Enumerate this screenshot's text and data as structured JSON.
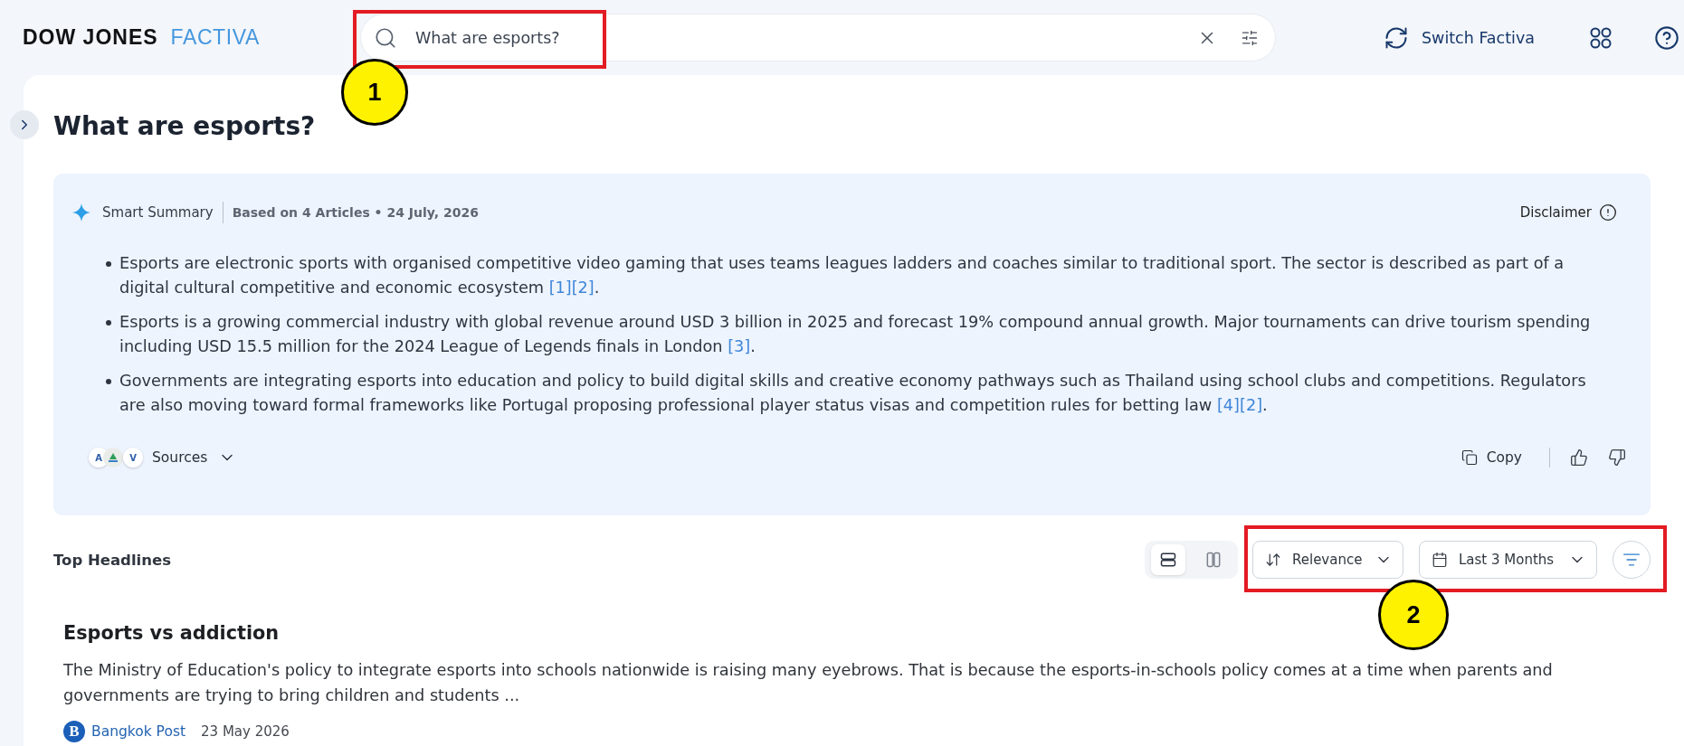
{
  "header": {
    "logo": {
      "primary": "DOW JONES",
      "secondary": "FACTIVA"
    },
    "search": {
      "value": "What are esports?",
      "callout": "1"
    },
    "switch_label": "Switch Factiva"
  },
  "page_title": "What are esports?",
  "summary": {
    "label": "Smart Summary",
    "meta": "Based on 4 Articles • 24 July, 2026",
    "disclaimer": "Disclaimer",
    "bullets": [
      {
        "text": "Esports are electronic sports with organised competitive video gaming that uses teams leagues ladders and coaches similar to traditional sport. The sector is described as part of a digital cultural competitive and economic ecosystem",
        "citations": [
          "[1]",
          "[2]"
        ],
        "end": "."
      },
      {
        "text": "Esports is a growing commercial industry with global revenue around USD 3 billion in 2025 and forecast 19% compound annual growth. Major tournaments can drive tourism spending including USD 15.5 million for the 2024 League of Legends finals in London",
        "citations": [
          "[3]"
        ],
        "end": "."
      },
      {
        "text": "Governments are integrating esports into education and policy to build digital skills and creative economy pathways such as Thailand using school clubs and competitions. Regulators are also moving toward formal frameworks like Portugal proposing professional player status visas and competition rules for betting law",
        "citations": [
          "[4]",
          "[2]"
        ],
        "end": "."
      }
    ],
    "sources": {
      "label": "Sources",
      "avatars": [
        {
          "kind": "letter",
          "label": "A"
        },
        {
          "kind": "logo"
        },
        {
          "kind": "letter",
          "label": "V"
        }
      ]
    },
    "copy_label": "Copy"
  },
  "headlines": {
    "title": "Top Headlines",
    "views": [
      {
        "kind": "list",
        "selected": true
      },
      {
        "kind": "columns",
        "selected": false
      }
    ],
    "sort": "Relevance",
    "date_range": "Last 3 Months",
    "callout": "2",
    "articles": [
      {
        "title": "Esports vs addiction",
        "snippet": "The Ministry of Education's policy to integrate esports into schools nationwide is raising many eyebrows. That is because the esports-in-schools policy comes at a time when parents and governments are trying to bring children and students ...",
        "publisher": "Bangkok Post",
        "logo_letter": "B",
        "date": "23 May 2026"
      }
    ]
  }
}
